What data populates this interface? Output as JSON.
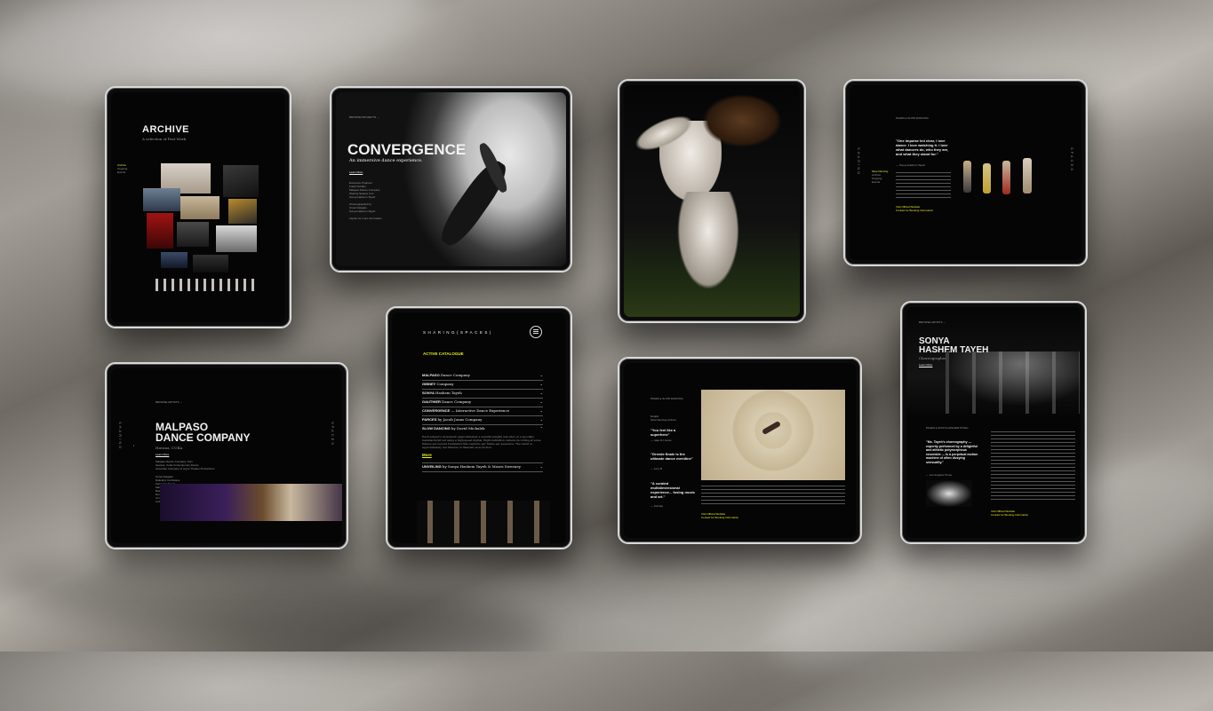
{
  "archive": {
    "title": "ARCHIVE",
    "subtitle": "A selection of Past Work",
    "side": [
      "Archive",
      "Ongoing",
      "Events"
    ]
  },
  "convergence": {
    "nav": "BROWSE PROJECTS",
    "title": "CONVERGENCE",
    "subtitle": "An immersive dance experience.",
    "learn": "Learn More",
    "credits": [
      "Executive Producer",
      "Frank Pohdler",
      "Malpaso Dance Company",
      "Sharing Spaces LLC",
      "Sonya Hashem Tayeh",
      "Choreographed by",
      "Osnel Delgado",
      "Sonya Hashem Tayeh",
      "Inquire for more information"
    ]
  },
  "slowdancing": {
    "crumb": "PAGES ▸ SLOW DANCING",
    "quote": "\"One impulse led clear, I love dance. I love watching it. I love what dancers do, who they are, and what they stand for.\"",
    "quote_by": "— Sonya Hashem Tayeh",
    "side": [
      "Slow Dancing",
      "Archive",
      "Ongoing",
      "Events"
    ],
    "links": [
      "Visit Official Website",
      "Contact for Booking Information"
    ],
    "vert_left": "SHARING",
    "vert_right": "SPACES"
  },
  "malpaso": {
    "nav": "BROWSE ARTISTS",
    "title_line1": "MALPASO",
    "title_line2": "DANCE COMPANY",
    "location": "Havana, CUBA",
    "learn": "Learn More",
    "info": [
      "Malpaso Dance Company, from",
      "Havana, Cuba Contemporary Dance",
      "Associate Company of Joyce Theater Productions"
    ],
    "members": [
      "Osnel Delgado",
      "Daileidys Carrazana",
      "Fernando Saenz",
      "Manuel Durán",
      "Beatriz García",
      "Dunia Acosta",
      "Armando Gómez",
      "Lisbeth Lazo"
    ]
  },
  "catalogue": {
    "brand": "SHARING(SPACES)",
    "heading": "ACTIVE CATALOGUE",
    "items": [
      {
        "name": "MALPASO",
        "rest": "Dance Company"
      },
      {
        "name": "GIBNEY",
        "rest": "Company"
      },
      {
        "name": "SONYA",
        "rest": "Hashem Tayeh"
      },
      {
        "name": "GAUTHIER",
        "rest": "Dance Company"
      },
      {
        "name": "CONVERGENCE",
        "rest": "— Interactive Dance Experience"
      },
      {
        "name": "PARCES",
        "rest": "by Jacob Jonas Company"
      },
      {
        "name": "SLOW DANCING",
        "rest": "by David Michalek"
      }
    ],
    "desc": "Each subject's movement (approximately a seventh-length) was shot on a specially manufactured set using a high-speed digital. Eight-definition camera recording at some frames per second translated film captures per frame per sequence. The result is approximately ten minutes of inherent slow motion.",
    "more": "More",
    "last": {
      "name": "UNVEILING",
      "rest": "by Sonya Hashem Tayeh & Moses Sweeney"
    }
  },
  "slowmotion": {
    "crumb": "PAGES ▸ SLOW DANCING",
    "side": "Details",
    "side2": "Slow Dancing Archive",
    "q1": "\"You feel like a superhero\"",
    "q1_by": "— Jake DJ Jones",
    "q2": "\"Greede finale is the ultimate dance meridine\"",
    "q2_by": "— Lucy B",
    "q3": "\"A curated multidimensional experience... fusing music and art.\"",
    "q3_by": "— Sunday",
    "links": [
      "Visit Official Website",
      "Contact for Booking Information"
    ]
  },
  "sonya": {
    "nav": "BROWSE ARTISTS",
    "name1": "SONYA",
    "name2": "HASHEM TAYEH",
    "role": "Choreographer",
    "learn": "Learn More",
    "crumb": "PAGES ▸ SONYA HASHEM TAYEH",
    "quote": "\"Ms. Tayeh's choreography — expertly performed by a delightful and athletic polymorphous ensemble — is a perpetual motion machine of often dizzying sensuality.\"",
    "quote_by": "— Los Angeles Times",
    "links": [
      "Visit Official Website",
      "Contact for Booking Information"
    ]
  }
}
